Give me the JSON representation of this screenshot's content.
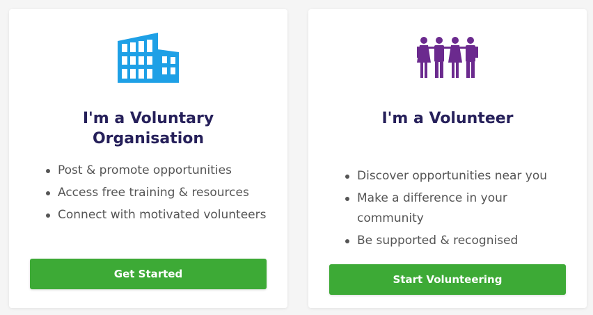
{
  "colors": {
    "title": "#26205a",
    "text": "#555555",
    "button": "#3daa36",
    "building_icon": "#1ea0e6",
    "people_icon": "#6b2a8e"
  },
  "org_card": {
    "icon": "building-icon",
    "title": "I'm a Voluntary Organisation",
    "bullets": [
      "Post & promote opportunities",
      "Access free training & resources",
      "Connect with motivated volunteers"
    ],
    "button_label": "Get Started"
  },
  "volunteer_card": {
    "icon": "people-icon",
    "title": "I'm a Volunteer",
    "bullets": [
      "Discover opportunities near you",
      "Make a difference in your community",
      "Be supported & recognised"
    ],
    "button_label": "Start Volunteering"
  }
}
